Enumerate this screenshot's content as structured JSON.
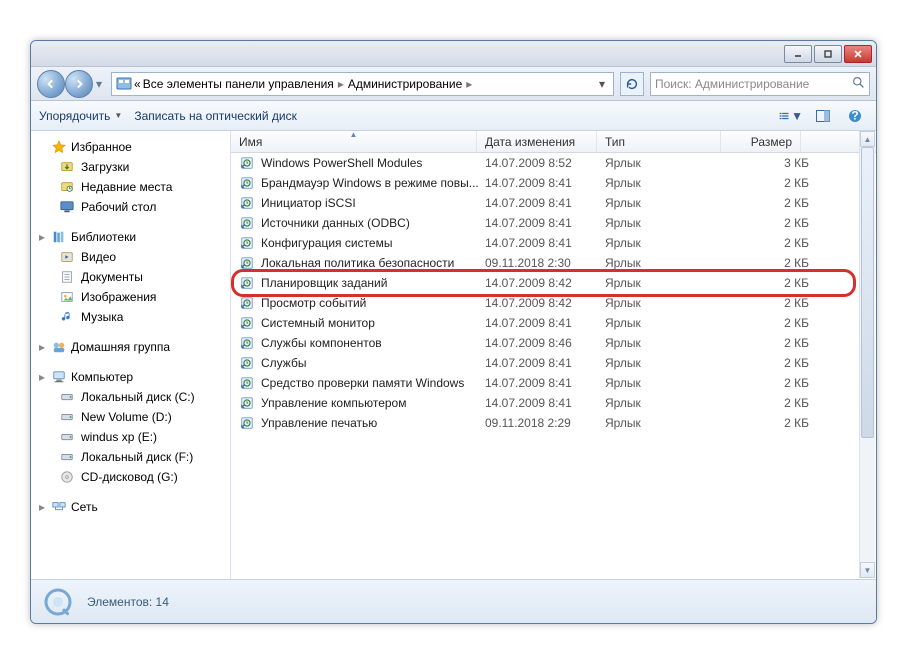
{
  "breadcrumb": {
    "prefix": "«",
    "seg1": "Все элементы панели управления",
    "seg2": "Администрирование"
  },
  "search": {
    "placeholder": "Поиск: Администрирование"
  },
  "toolbar": {
    "organize": "Упорядочить",
    "burn": "Записать на оптический диск"
  },
  "nav": {
    "favorites": {
      "label": "Избранное",
      "items": [
        {
          "label": "Загрузки"
        },
        {
          "label": "Недавние места"
        },
        {
          "label": "Рабочий стол"
        }
      ]
    },
    "libraries": {
      "label": "Библиотеки",
      "items": [
        {
          "label": "Видео"
        },
        {
          "label": "Документы"
        },
        {
          "label": "Изображения"
        },
        {
          "label": "Музыка"
        }
      ]
    },
    "homegroup": {
      "label": "Домашняя группа"
    },
    "computer": {
      "label": "Компьютер",
      "items": [
        {
          "label": "Локальный диск (C:)"
        },
        {
          "label": "New Volume (D:)"
        },
        {
          "label": "windus xp (E:)"
        },
        {
          "label": "Локальный диск (F:)"
        },
        {
          "label": "CD-дисковод (G:)"
        }
      ]
    },
    "network": {
      "label": "Сеть"
    }
  },
  "columns": {
    "name": "Имя",
    "date": "Дата изменения",
    "type": "Тип",
    "size": "Размер"
  },
  "files": [
    {
      "name": "Windows PowerShell Modules",
      "date": "14.07.2009 8:52",
      "type": "Ярлык",
      "size": "3 КБ"
    },
    {
      "name": "Брандмауэр Windows в режиме повы...",
      "date": "14.07.2009 8:41",
      "type": "Ярлык",
      "size": "2 КБ"
    },
    {
      "name": "Инициатор iSCSI",
      "date": "14.07.2009 8:41",
      "type": "Ярлык",
      "size": "2 КБ"
    },
    {
      "name": "Источники данных (ODBC)",
      "date": "14.07.2009 8:41",
      "type": "Ярлык",
      "size": "2 КБ"
    },
    {
      "name": "Конфигурация системы",
      "date": "14.07.2009 8:41",
      "type": "Ярлык",
      "size": "2 КБ"
    },
    {
      "name": "Локальная политика безопасности",
      "date": "09.11.2018 2:30",
      "type": "Ярлык",
      "size": "2 КБ"
    },
    {
      "name": "Планировщик заданий",
      "date": "14.07.2009 8:42",
      "type": "Ярлык",
      "size": "2 КБ",
      "highlight": true
    },
    {
      "name": "Просмотр событий",
      "date": "14.07.2009 8:42",
      "type": "Ярлык",
      "size": "2 КБ"
    },
    {
      "name": "Системный монитор",
      "date": "14.07.2009 8:41",
      "type": "Ярлык",
      "size": "2 КБ"
    },
    {
      "name": "Службы компонентов",
      "date": "14.07.2009 8:46",
      "type": "Ярлык",
      "size": "2 КБ"
    },
    {
      "name": "Службы",
      "date": "14.07.2009 8:41",
      "type": "Ярлык",
      "size": "2 КБ"
    },
    {
      "name": "Средство проверки памяти Windows",
      "date": "14.07.2009 8:41",
      "type": "Ярлык",
      "size": "2 КБ"
    },
    {
      "name": "Управление компьютером",
      "date": "14.07.2009 8:41",
      "type": "Ярлык",
      "size": "2 КБ"
    },
    {
      "name": "Управление печатью",
      "date": "09.11.2018 2:29",
      "type": "Ярлык",
      "size": "2 КБ"
    }
  ],
  "status": {
    "count_label": "Элементов: 14"
  }
}
